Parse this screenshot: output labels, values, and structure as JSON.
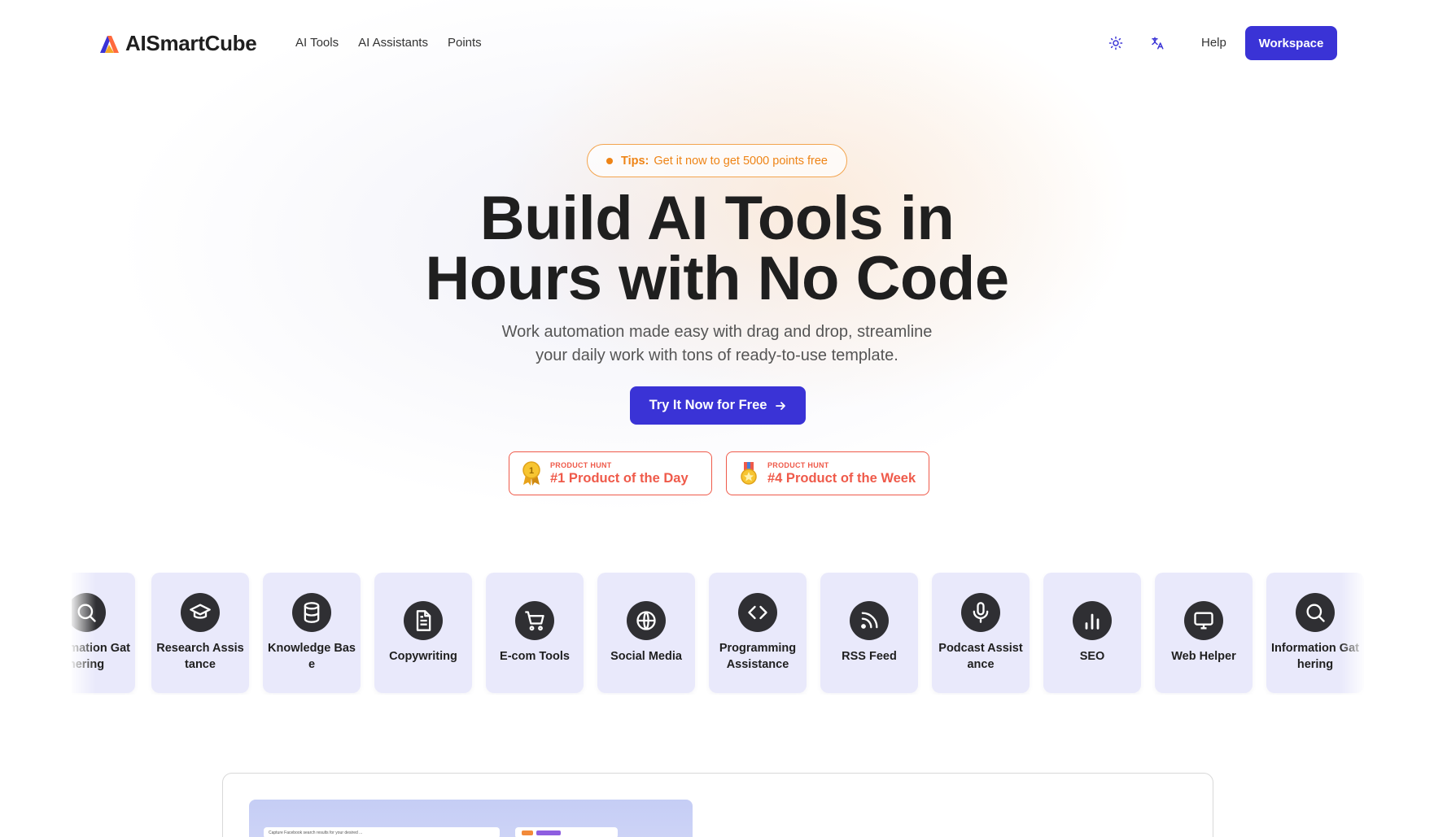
{
  "brand": {
    "name": "AISmartCube",
    "colors": {
      "primary": "#3a33d6",
      "accent_orange": "#ee8416",
      "badge_red": "#ef5a4a"
    }
  },
  "nav": {
    "items": [
      "AI Tools",
      "AI Assistants",
      "Points"
    ],
    "theme_icon": "sun-icon",
    "language_icon": "translate-icon",
    "help_label": "Help",
    "workspace_label": "Workspace"
  },
  "hero": {
    "tips_label": "Tips:",
    "tips_text": "Get it now to get 5000 points free",
    "title_line1": "Build AI Tools in",
    "title_line2": "Hours with No Code",
    "subtitle_line1": "Work automation made easy with drag and drop, streamline",
    "subtitle_line2": "your daily work with tons of ready-to-use template.",
    "cta_label": "Try It Now for Free"
  },
  "badges": [
    {
      "small": "PRODUCT HUNT",
      "big": "#1 Product of the Day",
      "icon": "gold-medal-icon"
    },
    {
      "small": "PRODUCT HUNT",
      "big": "#4 Product of the Week",
      "icon": "ribbon-medal-icon"
    }
  ],
  "categories": [
    {
      "label": "Information Gathering",
      "icon": "search-icon"
    },
    {
      "label": "Research Assistance",
      "icon": "graduation-cap-icon"
    },
    {
      "label": "Knowledge Base",
      "icon": "database-icon"
    },
    {
      "label": "Copywriting",
      "icon": "document-icon"
    },
    {
      "label": "E-com Tools",
      "icon": "cart-icon"
    },
    {
      "label": "Social Media",
      "icon": "globe-icon"
    },
    {
      "label": "Programming Assistance",
      "icon": "code-icon"
    },
    {
      "label": "RSS Feed",
      "icon": "rss-icon"
    },
    {
      "label": "Podcast Assistance",
      "icon": "microphone-icon"
    },
    {
      "label": "SEO",
      "icon": "bar-chart-icon"
    },
    {
      "label": "Web Helper",
      "icon": "monitor-icon"
    },
    {
      "label": "Information Gathering",
      "icon": "search-icon"
    }
  ],
  "preview": {
    "search_text": "Capture Facebook search results for your desired ..."
  }
}
